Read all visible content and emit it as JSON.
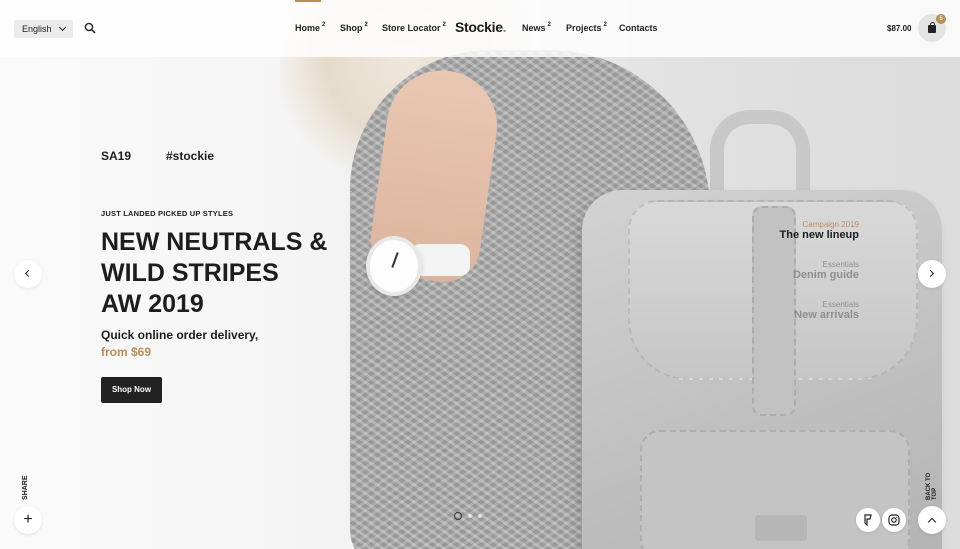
{
  "header": {
    "language": "English",
    "nav": [
      {
        "label": "Home",
        "sup": "2"
      },
      {
        "label": "Shop",
        "sup": "2"
      },
      {
        "label": "Store Locator",
        "sup": "2"
      },
      {
        "label": "News",
        "sup": "2"
      },
      {
        "label": "Projects",
        "sup": "2"
      },
      {
        "label": "Contacts",
        "sup": ""
      }
    ],
    "logo": "Stockie",
    "logo_dot": ".",
    "cart_total": "$87.00",
    "cart_count": "6"
  },
  "hero": {
    "tag1": "SA19",
    "tag2": "#stockie",
    "eyebrow": "JUST LANDED PICKED UP STYLES",
    "headline": [
      "NEW NEUTRALS &",
      "WILD STRIPES",
      "AW 2019"
    ],
    "subline": "Quick online order delivery,",
    "price_line": "from $69",
    "cta": "Shop Now"
  },
  "slide_menu": [
    {
      "eyebrow": "Campaign 2019",
      "title": "The new lineup",
      "active": true
    },
    {
      "eyebrow": "Essentials",
      "title": "Denim guide",
      "active": false
    },
    {
      "eyebrow": "Essentials",
      "title": "New arrivals",
      "active": false
    }
  ],
  "footer": {
    "share_label": "SHARE",
    "back_label": "BACK TO TOP"
  },
  "colors": {
    "accent": "#b88e59",
    "dark": "#222222"
  },
  "icons": [
    "search-icon",
    "chevron-down-icon",
    "shopping-bag-icon",
    "arrow-left-icon",
    "arrow-right-icon",
    "plus-icon",
    "foursquare-icon",
    "instagram-icon",
    "chevron-up-icon"
  ]
}
